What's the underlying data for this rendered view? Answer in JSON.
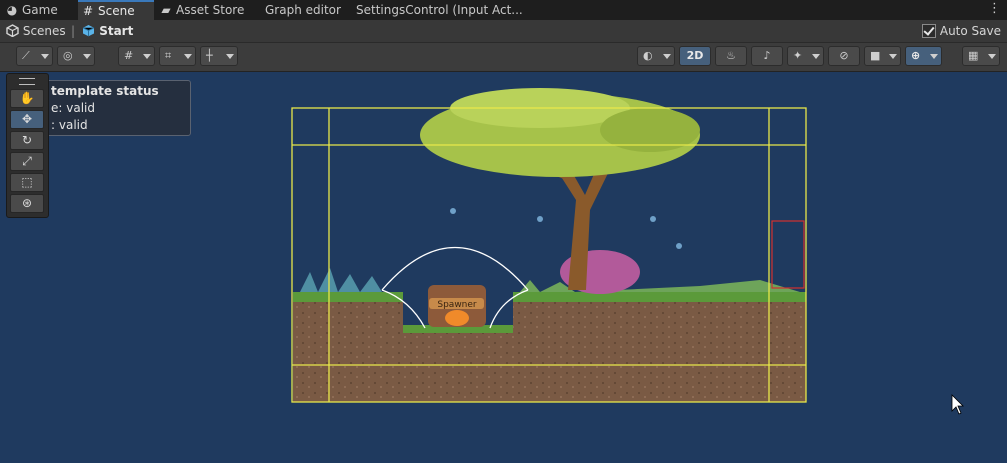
{
  "tabs": [
    {
      "label": "Game",
      "icon": "gamepad-icon",
      "glyph": "◕"
    },
    {
      "label": "Scene",
      "icon": "grid-icon",
      "glyph": "#"
    },
    {
      "label": "Asset Store",
      "icon": "shopping-bag-icon",
      "glyph": "▰"
    },
    {
      "label": "Graph editor",
      "icon": "",
      "glyph": ""
    },
    {
      "label": "SettingsControl (Input Act...",
      "icon": "",
      "glyph": ""
    }
  ],
  "breadcrumb": {
    "scenes": "Scenes",
    "separator": "|",
    "current": "Start"
  },
  "autosave": {
    "label": "Auto Save",
    "checked": true
  },
  "toolbar": {
    "view_2d": "2D",
    "left_buttons": [
      "draw-mode-icon",
      "global-icon",
      "snap-grid-icon",
      "grid-plane-icon",
      "increment-snap-icon"
    ],
    "right_buttons": [
      "shading-icon",
      "lighting-icon",
      "audio-icon",
      "effects-icon",
      "visibility-icon",
      "camera-icon",
      "gizmos-icon",
      "overlays-icon"
    ]
  },
  "overlay": {
    "line1": "template status",
    "line2": "e: valid",
    "line3": ": valid"
  },
  "tools": [
    "hand-tool-icon",
    "move-tool-icon",
    "rotate-tool-icon",
    "scale-tool-icon",
    "rect-tool-icon",
    "transform-tool-icon"
  ],
  "scene": {
    "spawner_label": "Spawner",
    "colors": {
      "background": "#1f3a5f",
      "bounds": "#e8e84a",
      "ground": "#7a5a44",
      "grass": "#5b9a3a"
    }
  }
}
